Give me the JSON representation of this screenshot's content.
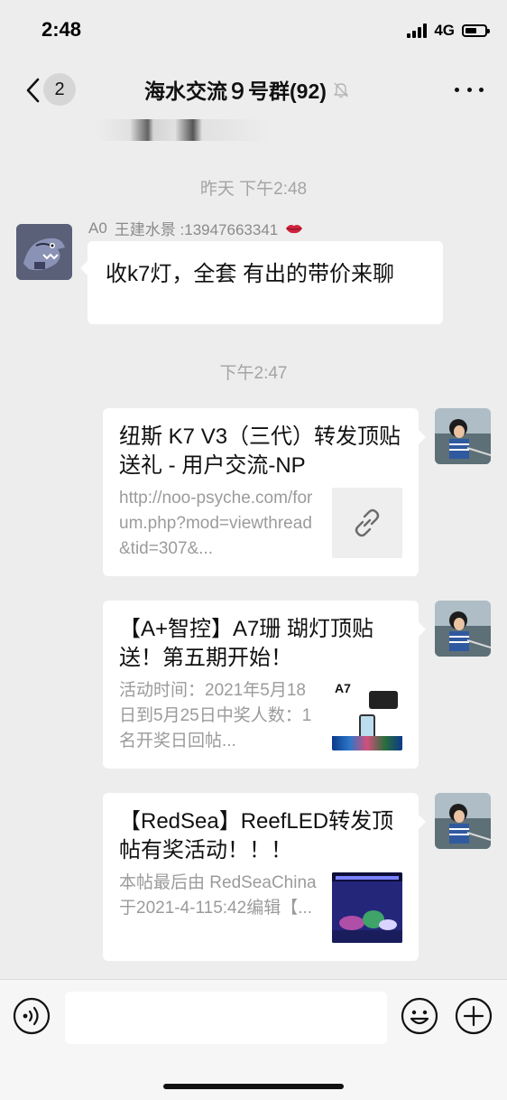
{
  "status_bar": {
    "time": "2:48",
    "network": "4G"
  },
  "nav": {
    "back_badge": "2",
    "title": "海水交流９号群(92)",
    "icons": [
      "back-chevron-icon",
      "mute-bell-icon",
      "more-dots-icon"
    ]
  },
  "chat": {
    "timestamp_1": "昨天 下午2:48",
    "message_1": {
      "sender_prefix": "A0",
      "sender_name": "王建水景 :13947663341",
      "text": "收k7灯，全套  有出的带价来聊"
    },
    "timestamp_2": "下午2:47",
    "cards": [
      {
        "title": "纽斯 K7 V3（三代）转发顶贴送礼 - 用户交流-NP",
        "desc": "http://noo-psyche.com/forum.php?mod=viewthread&tid=307&...",
        "thumb": "link-icon"
      },
      {
        "title": "【A+智控】A7珊 瑚灯顶贴送！第五期开始！",
        "desc": "活动时间：2021年5月18日到5月25日中奖人数：1名开奖日回帖...",
        "thumb_label": "A7"
      },
      {
        "title": "【RedSea】ReefLED转发顶帖有奖活动！！！",
        "desc": "本帖最后由 RedSeaChina于2021-4-115:42编辑【...",
        "thumb": "reef-photo"
      }
    ]
  },
  "input_bar": {
    "placeholder": "",
    "icons": [
      "voice-icon",
      "emoji-icon",
      "add-icon"
    ]
  },
  "colors": {
    "background": "#ededed",
    "bubble": "#ffffff",
    "timestamp": "#a4a4a4",
    "secondary_text": "#9b9b9b",
    "emoji_lips": "#d0243c"
  }
}
